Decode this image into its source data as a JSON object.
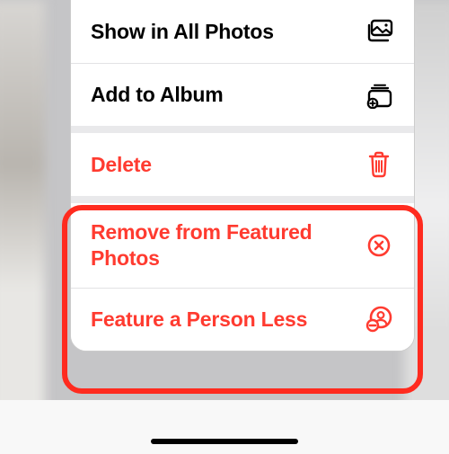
{
  "colors": {
    "destructive": "#ff3b30",
    "highlight": "#ff2b1f"
  },
  "menu": {
    "groups": [
      {
        "items": [
          {
            "label": "Show in All Photos",
            "icon": "photo-rect-icon",
            "destructive": false
          },
          {
            "label": "Add to Album",
            "icon": "album-add-icon",
            "destructive": false
          }
        ]
      },
      {
        "items": [
          {
            "label": "Delete",
            "icon": "trash-icon",
            "destructive": true
          }
        ]
      },
      {
        "items": [
          {
            "label": "Remove from Featured Photos",
            "icon": "x-circle-icon",
            "destructive": true
          },
          {
            "label": "Feature a Person Less",
            "icon": "person-minus-icon",
            "destructive": true
          }
        ]
      }
    ]
  }
}
